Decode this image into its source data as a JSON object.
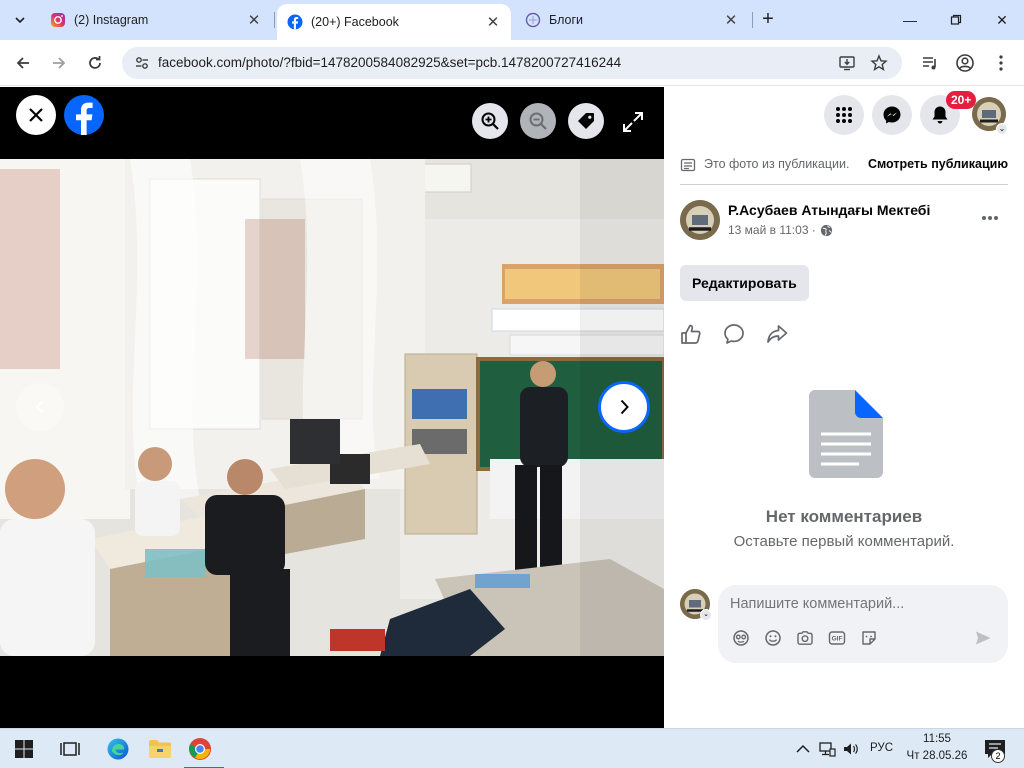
{
  "browser": {
    "tabs": [
      {
        "title": "(2) Instagram",
        "active": false
      },
      {
        "title": "(20+) Facebook",
        "active": true
      },
      {
        "title": "Блоги",
        "active": false
      }
    ],
    "url": "facebook.com/photo/?fbid=1478200584082925&set=pcb.1478200727416244"
  },
  "viewer": {
    "icons": [
      "close-icon",
      "facebook-logo",
      "zoom-in-icon",
      "zoom-out-icon",
      "tag-icon",
      "fullscreen-icon",
      "chevron-left-icon",
      "chevron-right-icon"
    ]
  },
  "panel": {
    "notification_badge": "20+",
    "publication_note": "Это фото из публикации.",
    "publication_link": "Смотреть публикацию",
    "author_name": "Р.Асубаев Атындағы Мектебі",
    "post_date": "13 май в 11:03 ·",
    "edit_label": "Редактировать",
    "no_comments_title": "Нет комментариев",
    "no_comments_sub": "Оставьте первый комментарий.",
    "comment_placeholder": "Напишите комментарий..."
  },
  "taskbar": {
    "lang": "РУС",
    "time": "11:55",
    "date": "Чт 28.05.26",
    "notification_count": "2"
  },
  "colors": {
    "facebook_blue": "#0866ff",
    "badge_red": "#e41e3f",
    "tabstrip_bg": "#d3e3fd",
    "taskbar_bg": "#dde9f5"
  }
}
